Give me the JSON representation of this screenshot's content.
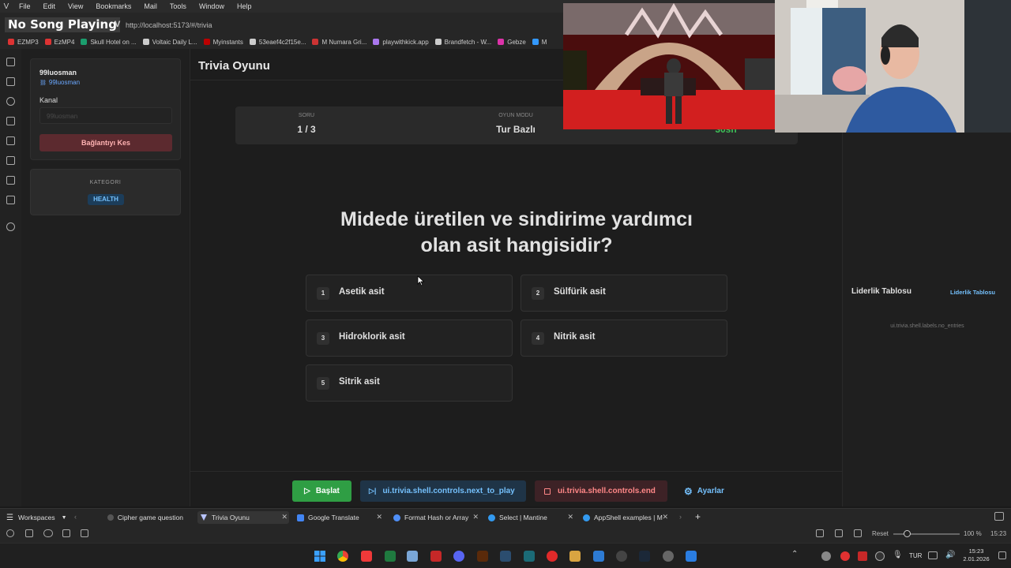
{
  "menubar": {
    "items": [
      "File",
      "Edit",
      "View",
      "Bookmarks",
      "Mail",
      "Tools",
      "Window",
      "Help"
    ]
  },
  "now_playing": "No Song Playing",
  "address": {
    "url": "http://localhost:5173/#/trivia",
    "v_label": "V"
  },
  "bookmarks": [
    {
      "label": "EZMP3",
      "color": "#d33"
    },
    {
      "label": "EzMP4",
      "color": "#d33"
    },
    {
      "label": "Skull Hotel on ...",
      "color": "#1b9e6e"
    },
    {
      "label": "Voltaic Daily L...",
      "color": "#ccc"
    },
    {
      "label": "Myinstants",
      "color": "#b00"
    },
    {
      "label": "53eaef4c2f15e...",
      "color": "#ccc"
    },
    {
      "label": "M Numara Gri...",
      "color": "#c33"
    },
    {
      "label": "playwithkick.app",
      "color": "#a7e"
    },
    {
      "label": "Brandfetch - W...",
      "color": "#ccc"
    },
    {
      "label": "Gebze",
      "color": "#d3a"
    },
    {
      "label": "M",
      "color": "#39f"
    }
  ],
  "sidebar": {
    "user": "99luosman",
    "user_link": "99luosman",
    "channel_label": "Kanal",
    "channel_placeholder": "99luosman",
    "disconnect_label": "Bağlantıyı Kes",
    "category_label": "KATEGORI",
    "category_value": "HEALTH"
  },
  "game": {
    "title": "Trivia Oyunu",
    "stats": {
      "question_label": "SORU",
      "question_value": "1 / 3",
      "mode_label": "OYUN MODU",
      "mode_value": "Tur Bazlı",
      "time_value": "30sn"
    },
    "question_line1": "Midede üretilen ve sindirime yardımcı",
    "question_line2": "olan asit hangisidir?",
    "answers": [
      {
        "num": "1",
        "text": "Asetik asit"
      },
      {
        "num": "2",
        "text": "Sülfürik asit"
      },
      {
        "num": "3",
        "text": "Hidroklorik asit"
      },
      {
        "num": "4",
        "text": "Nitrik asit"
      },
      {
        "num": "5",
        "text": "Sitrik asit"
      }
    ]
  },
  "controls": {
    "start": "Başlat",
    "next": "ui.trivia.shell.controls.next_to_play",
    "end": "ui.trivia.shell.controls.end",
    "settings": "Ayarlar"
  },
  "leaderboard": {
    "title": "Liderlik Tablosu",
    "link": "Liderlik Tablosu",
    "empty": "ui.trivia.shell.labels.no_entries"
  },
  "tabs": {
    "workspaces": "Workspaces",
    "items": [
      {
        "label": "Cipher game question"
      },
      {
        "label": "Trivia Oyunu"
      },
      {
        "label": "Google Translate"
      },
      {
        "label": "Format Hash or Array"
      },
      {
        "label": "Select | Mantine"
      },
      {
        "label": "AppShell examples | M"
      }
    ]
  },
  "status": {
    "reset": "Reset",
    "zoom": "100 %",
    "time": "15:23"
  },
  "taskbar": {
    "lang": "TUR",
    "clock_time": "15:23",
    "clock_date": "2.01.2026"
  },
  "colors": {
    "accent_green": "#2f9e44",
    "time_green": "#40c057",
    "danger": "#e03131",
    "link_blue": "#74c0fc"
  }
}
